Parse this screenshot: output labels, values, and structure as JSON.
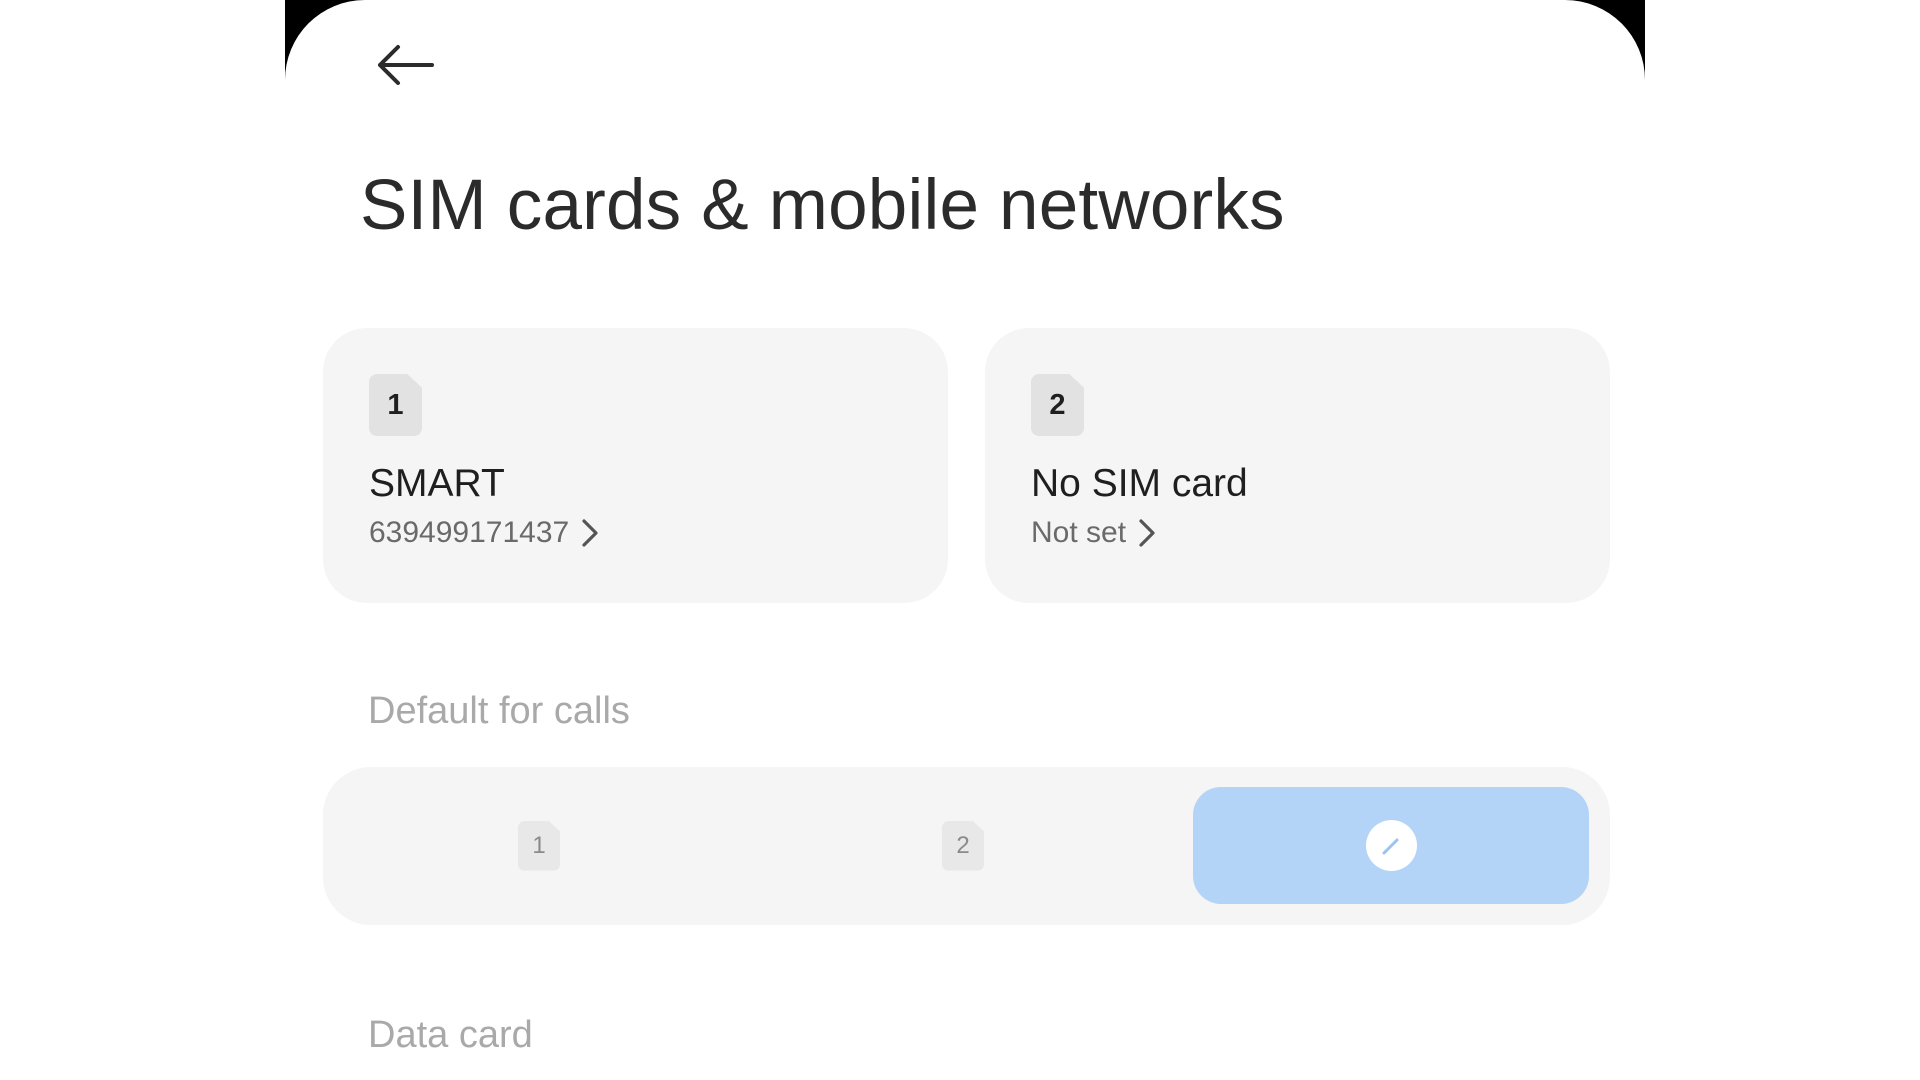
{
  "header": {
    "back_icon": "arrow-left-icon",
    "title": "SIM cards & mobile networks"
  },
  "sim_cards": [
    {
      "slot": "1",
      "name": "SMART",
      "detail": "639499171437",
      "chevron_icon": "chevron-right-icon"
    },
    {
      "slot": "2",
      "name": "No SIM card",
      "detail": "Not set",
      "chevron_icon": "chevron-right-icon"
    }
  ],
  "default_for_calls": {
    "label": "Default for calls",
    "options": [
      {
        "label": "1",
        "selected": false
      },
      {
        "label": "2",
        "selected": false
      },
      {
        "icon": "pencil-icon",
        "selected": true
      }
    ],
    "selected_color": "#b3d4f7"
  },
  "data_card": {
    "label": "Data card"
  },
  "colors": {
    "card_background": "#f5f5f5",
    "title_text": "#2b2b2b",
    "muted_label": "#a9a9a9",
    "accent": "#b3d4f7"
  }
}
